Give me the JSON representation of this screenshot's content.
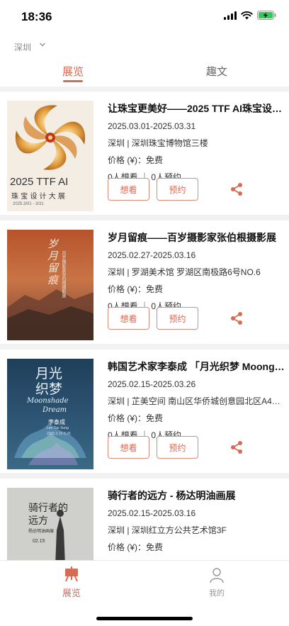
{
  "status_bar": {
    "time": "18:36"
  },
  "location": {
    "city": "深圳"
  },
  "tabs": [
    {
      "label": "展览",
      "active": true
    },
    {
      "label": "趣文",
      "active": false
    }
  ],
  "exhibitions": [
    {
      "title": "让珠宝更美好——2025 TTF AI珠宝设…",
      "dates": "2025.03.01-2025.03.31",
      "venue": "深圳 | 深圳珠宝博物馆三楼",
      "price": "价格 (¥)：免费",
      "stats": "0人想看 ｜ 0人预约",
      "poster": {
        "line1": "2025 TTF AI",
        "line2": "珠 宝 设 计 大 展",
        "small": "2025.3/01 - 3/31"
      }
    },
    {
      "title": "岁月留痕——百岁摄影家张伯根摄影展",
      "dates": "2025.02.27-2025.03.16",
      "venue": "深圳 | 罗湖美术馆 罗湖区南极路6号NO.6",
      "price": "价格 (¥)：免费",
      "stats": "0人想看 ｜ 0人预约",
      "poster": {
        "line1": "岁月留痕",
        "line2": "百岁摄影家张伯根摄影展"
      }
    },
    {
      "title": "韩国艺术家李泰成 「月光织梦 Moong…",
      "dates": "2025.02.15-2025.03.26",
      "venue": "深圳 | 芷美空间 南山区华侨城创意园北区A4…",
      "price": "价格 (¥)：免费",
      "stats": "0人想看 ｜ 0人预约",
      "poster": {
        "line1": "月光",
        "line2": "织梦",
        "line3": "Moonshade",
        "line4": "Dream",
        "line5": "李泰成",
        "line6": "Lee Tae Sung",
        "line7": "2025.2.15-3.26"
      }
    },
    {
      "title": "骑行者的远方 - 杨达明油画展",
      "dates": "2025.02.15-2025.03.16",
      "venue": "深圳 | 深圳红立方公共艺术馆3F",
      "price": "价格 (¥)：免费",
      "stats": "",
      "poster": {
        "line1": "骑行者的",
        "line2": "远方",
        "line3": "杨达明油画展",
        "line4": "02.15"
      }
    }
  ],
  "buttons": {
    "want": "想看",
    "reserve": "预约"
  },
  "bottom_nav": [
    {
      "label": "展览",
      "active": true
    },
    {
      "label": "我的",
      "active": false
    }
  ],
  "colors": {
    "accent": "#d66b56",
    "background": "#f2f2f2"
  }
}
